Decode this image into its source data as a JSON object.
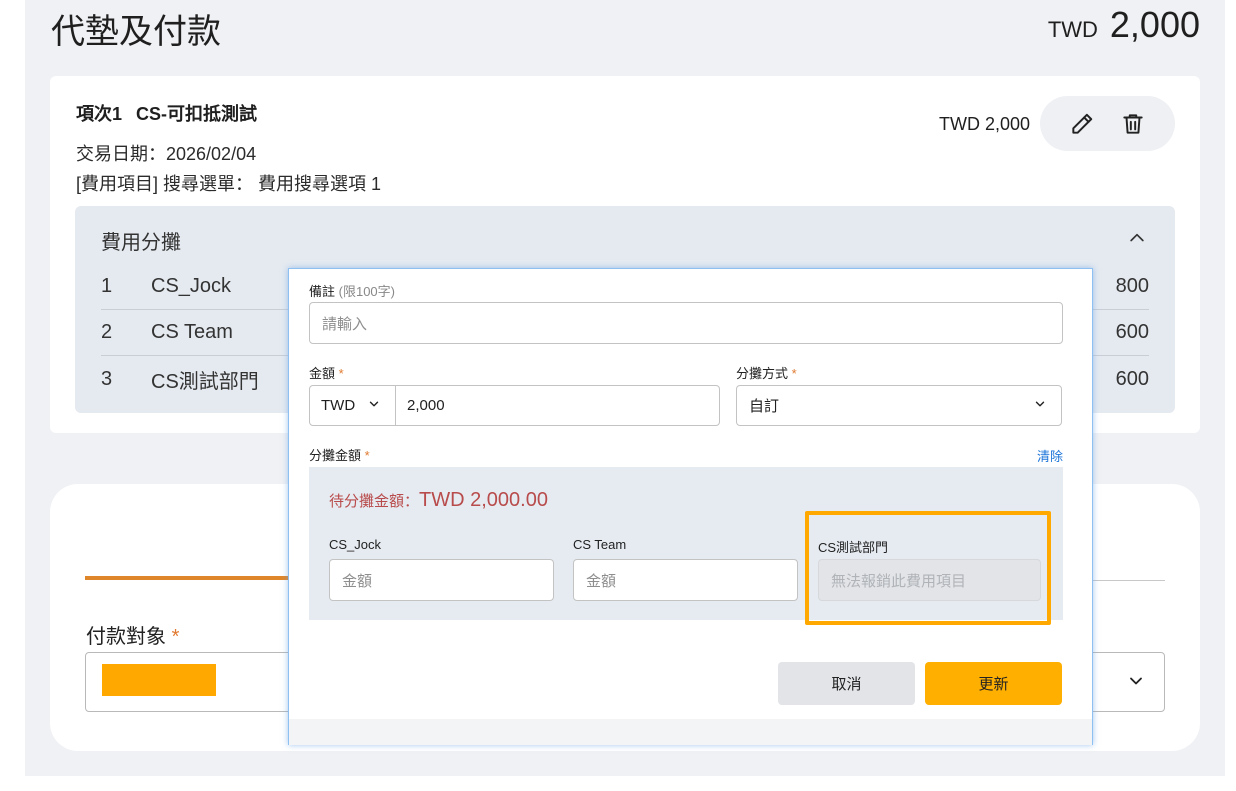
{
  "header": {
    "title": "代墊及付款",
    "total_currency": "TWD",
    "total_amount": "2,000"
  },
  "item": {
    "index_label": "項次1",
    "name": "CS-可扣抵測試",
    "date_line": "交易日期：2026/02/04",
    "expense_line": "[費用項目] 搜尋選單： 費用搜尋選項 1",
    "amount": "TWD 2,000",
    "edit_icon": "pencil-icon",
    "delete_icon": "trash-icon"
  },
  "allocation": {
    "title": "費用分攤",
    "rows": [
      {
        "num": "1",
        "name": "CS_Jock",
        "value": "800"
      },
      {
        "num": "2",
        "name": "CS Team",
        "value": "600"
      },
      {
        "num": "3",
        "name": "CS測試部門",
        "value": "600"
      }
    ]
  },
  "payment": {
    "label": "付款對象",
    "required_mark": "*"
  },
  "modal": {
    "note_label": "備註",
    "note_hint": "(限100字)",
    "note_placeholder": "請輸入",
    "amount_label": "金額",
    "currency": "TWD",
    "amount_value": "2,000",
    "method_label": "分攤方式",
    "method_value": "自訂",
    "split_label": "分攤金額",
    "clear_label": "清除",
    "pending_label": "待分攤金額：",
    "pending_amount": "TWD 2,000.00",
    "departments": [
      {
        "name": "CS_Jock",
        "placeholder": "金額"
      },
      {
        "name": "CS Team",
        "placeholder": "金額"
      },
      {
        "name": "CS測試部門",
        "placeholder": "無法報銷此費用項目"
      }
    ],
    "cancel_label": "取消",
    "update_label": "更新",
    "required_mark": "*"
  },
  "colors": {
    "accent_orange": "#ffa800",
    "tab_orange": "#e0862a",
    "link_blue": "#1a73d9",
    "pending_red": "#b84b4b"
  }
}
